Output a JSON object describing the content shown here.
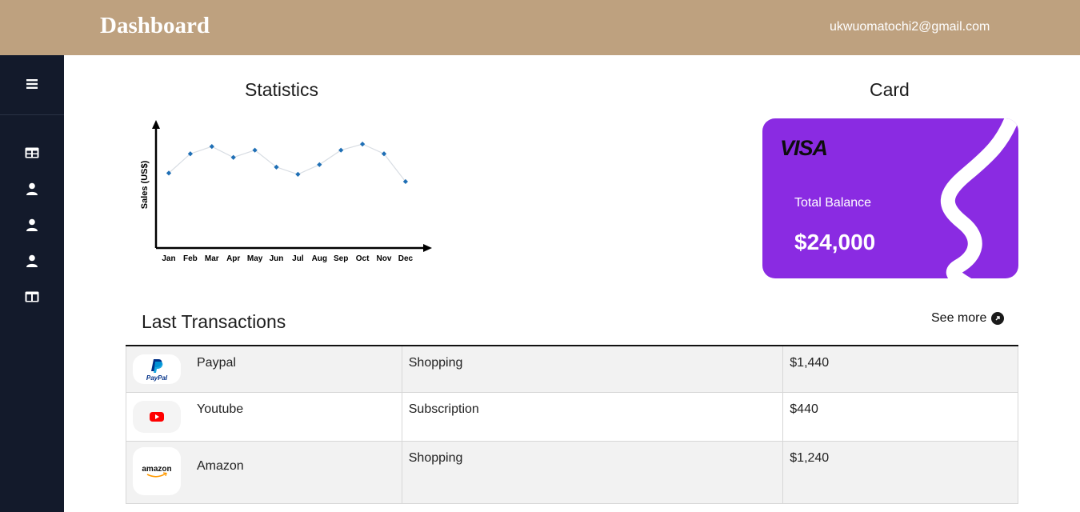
{
  "header": {
    "title": "Dashboard",
    "user_email": "ukwuomatochi2@gmail.com"
  },
  "sidebar": {
    "items": [
      {
        "icon": "menu-icon"
      },
      {
        "icon": "dashboard-icon"
      },
      {
        "icon": "user-icon"
      },
      {
        "icon": "user-icon"
      },
      {
        "icon": "user-icon"
      },
      {
        "icon": "columns-icon"
      }
    ]
  },
  "statistics": {
    "title": "Statistics"
  },
  "chart_data": {
    "type": "line",
    "title": "",
    "xlabel": "",
    "ylabel": "Sales (US$)",
    "categories": [
      "Jan",
      "Feb",
      "Mar",
      "Apr",
      "May",
      "Jun",
      "Jul",
      "Aug",
      "Sep",
      "Oct",
      "Nov",
      "Dec"
    ],
    "series": [
      {
        "values": [
          62,
          78,
          84,
          75,
          81,
          67,
          61,
          69,
          81,
          86,
          78,
          55
        ]
      }
    ],
    "ylim": [
      0,
      100
    ],
    "grid": false,
    "color": "#1f6fb5"
  },
  "card": {
    "title": "Card",
    "brand": "VISA",
    "balance_label": "Total Balance",
    "balance": "$24,000",
    "color": "#8a2be2"
  },
  "transactions": {
    "title": "Last Transactions",
    "see_more": "See more",
    "rows": [
      {
        "merchant": "Paypal",
        "icon": "paypal-logo",
        "category": "Shopping",
        "amount": "$1,440"
      },
      {
        "merchant": "Youtube",
        "icon": "youtube-logo",
        "category": "Subscription",
        "amount": "$440"
      },
      {
        "merchant": "Amazon",
        "icon": "amazon-logo",
        "category": "Shopping",
        "amount": "$1,240"
      }
    ]
  }
}
